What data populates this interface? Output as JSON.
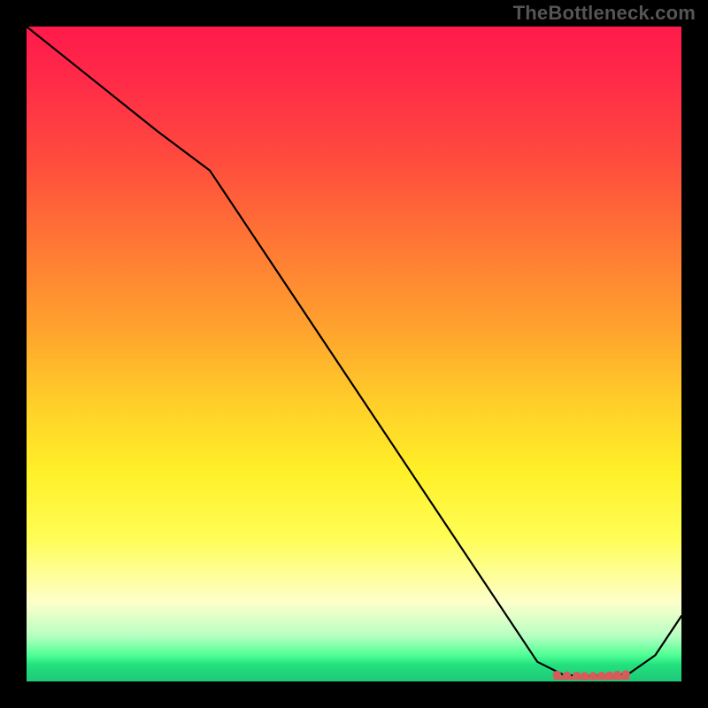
{
  "watermark": "TheBottleneck.com",
  "chart_data": {
    "type": "line",
    "title": "",
    "xlabel": "",
    "ylabel": "",
    "xlim": [
      0,
      100
    ],
    "ylim": [
      0,
      100
    ],
    "grid": false,
    "legend": false,
    "x": [
      0,
      10,
      20,
      28,
      40,
      50,
      60,
      70,
      78,
      82,
      86,
      90,
      92,
      96,
      100
    ],
    "values": [
      100,
      92,
      84,
      78,
      60,
      45,
      30,
      15,
      3,
      1,
      0.8,
      1,
      1.2,
      4,
      10
    ],
    "marker_cluster_x": [
      81,
      82.5,
      84,
      85.2,
      86.5,
      87.8,
      89,
      90.2,
      91.5
    ],
    "marker_cluster_y": [
      1.0,
      0.9,
      0.85,
      0.8,
      0.8,
      0.85,
      0.9,
      1.0,
      1.1
    ]
  },
  "colors": {
    "gradient_top": "#ff1a4b",
    "gradient_mid": "#fff028",
    "gradient_bottom": "#1fc877",
    "curve": "#000000",
    "markers": "#d85a5a"
  }
}
